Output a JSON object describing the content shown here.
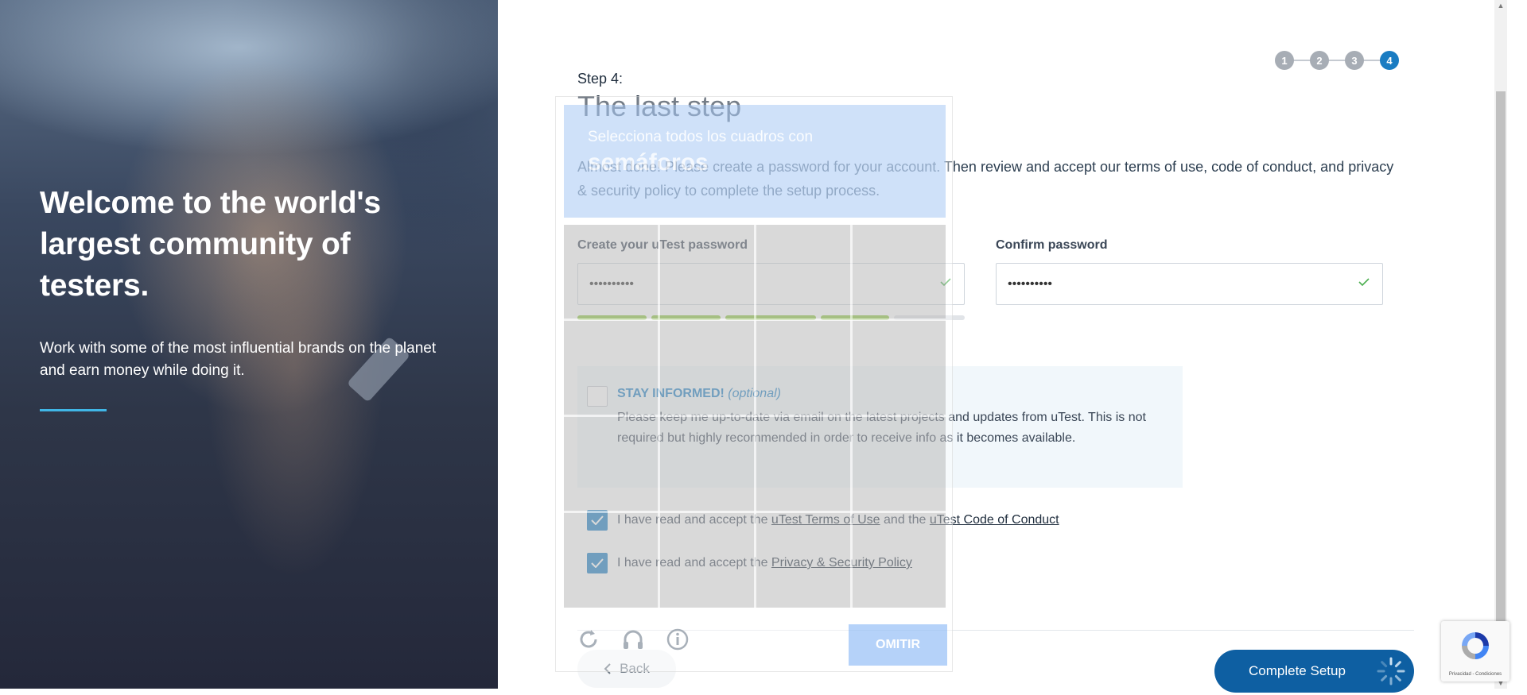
{
  "hero": {
    "headline": "Welcome to the world's largest community of testers.",
    "subtext": "Work with some of the most influential brands on the planet and earn money while doing it."
  },
  "stepper": {
    "steps": [
      "1",
      "2",
      "3",
      "4"
    ],
    "current": 4
  },
  "form": {
    "step_label": "Step 4:",
    "title": "The last step",
    "intro": "Almost done! Please create a password for your account. Then review and accept our terms of use, code of conduct, and privacy & security policy to complete the setup process.",
    "password_label": "Create your uTest password",
    "password_value": "••••••••••",
    "confirm_label": "Confirm password",
    "confirm_value": "••••••••••",
    "password_strength": 0.8,
    "stay_informed": {
      "heading": "STAY INFORMED!",
      "optional": "(optional)",
      "description": "Please keep me up-to-date via email on the latest projects and updates from uTest. This is not required but highly recommended in order to receive info as it becomes available.",
      "checked": false
    },
    "terms": {
      "prefix": "I have read and accept the",
      "link1": "uTest Terms of Use",
      "middle": "and the",
      "link2": "uTest Code of Conduct",
      "checked": true
    },
    "privacy": {
      "prefix": "I have read and accept the",
      "link": "Privacy & Security Policy",
      "checked": true
    },
    "back_label": "Back",
    "complete_label": "Complete Setup"
  },
  "captcha": {
    "instruction": "Selecciona todos los cuadros con",
    "target": "semáforos",
    "skip_label": "OMITIR"
  },
  "recaptcha_badge": {
    "text": "Privacidad - Condiciones"
  },
  "colors": {
    "primary": "#1a7cc2",
    "button": "#0e5fa2",
    "strength": "#8cc63f",
    "accent_line": "#40b6e6"
  }
}
